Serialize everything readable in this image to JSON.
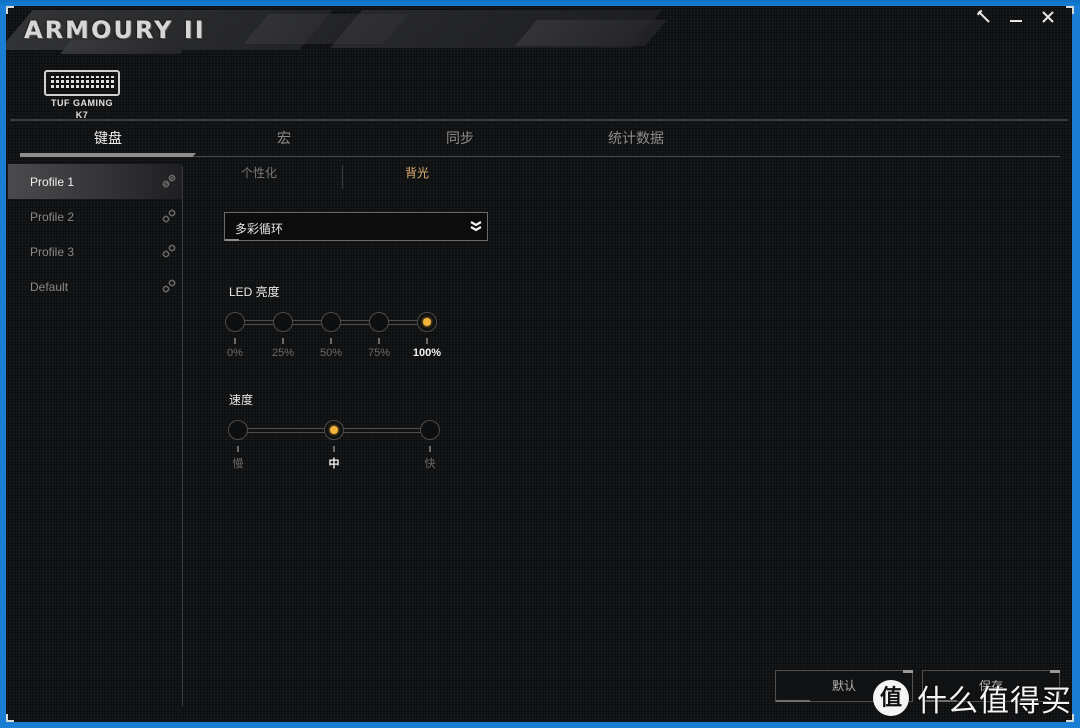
{
  "app": {
    "title": "ARMOURY II"
  },
  "window_controls": {
    "settings_icon": "wrench-icon",
    "minimize_icon": "minimize-icon",
    "close_icon": "close-icon"
  },
  "device": {
    "name_line1": "TUF GAMING",
    "name_line2": "K7",
    "icon": "keyboard-icon"
  },
  "main_tabs": [
    {
      "label": "键盘",
      "active": true
    },
    {
      "label": "宏",
      "active": false
    },
    {
      "label": "同步",
      "active": false
    },
    {
      "label": "统计数据",
      "active": false
    }
  ],
  "profiles": [
    {
      "label": "Profile 1",
      "active": true,
      "icon": "link-icon"
    },
    {
      "label": "Profile 2",
      "active": false,
      "icon": "link-icon"
    },
    {
      "label": "Profile 3",
      "active": false,
      "icon": "link-icon"
    },
    {
      "label": "Default",
      "active": false,
      "icon": "link-icon"
    }
  ],
  "sub_tabs": [
    {
      "label": "个性化",
      "active": false
    },
    {
      "label": "背光",
      "active": true
    }
  ],
  "effect_dropdown": {
    "selected": "多彩循环",
    "icon": "double-chevron-down-icon"
  },
  "brightness": {
    "label": "LED 亮度",
    "options": [
      "0%",
      "25%",
      "50%",
      "75%",
      "100%"
    ],
    "selected_index": 4,
    "value_percent": 100
  },
  "speed": {
    "label": "速度",
    "options": [
      "慢",
      "中",
      "快"
    ],
    "selected_index": 1
  },
  "buttons": {
    "default_label": "默认",
    "save_label": "保存"
  },
  "watermark": {
    "badge": "值",
    "text": "什么值得买"
  },
  "colors": {
    "accent": "#f3b33c",
    "active_subtab": "#e0b070",
    "window_border": "#1a7fd4"
  }
}
